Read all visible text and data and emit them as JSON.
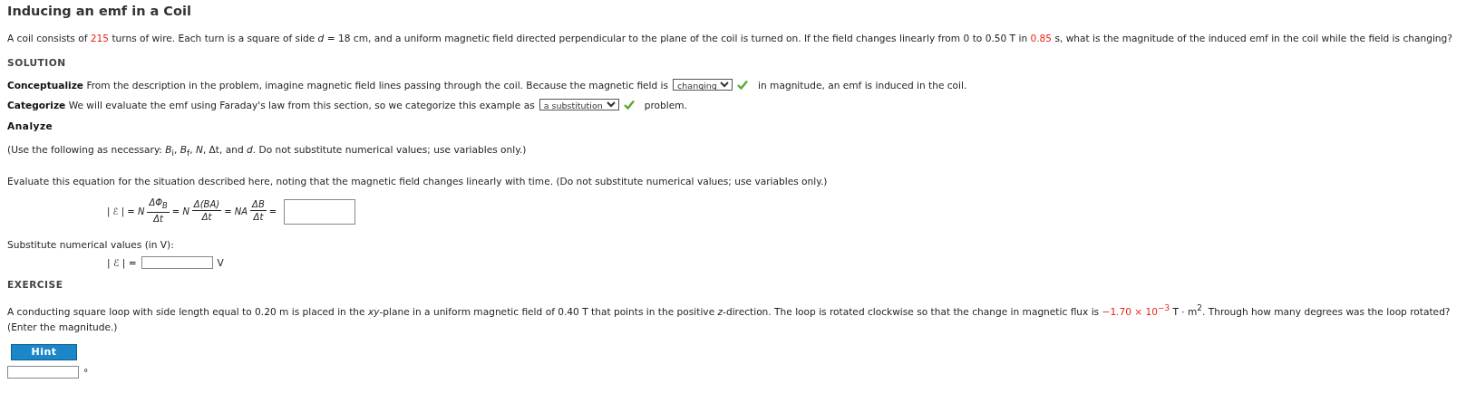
{
  "title": "Inducing an emf in a Coil",
  "problem": [
    {
      "kind": "plain",
      "text": "A coil consists of "
    },
    {
      "kind": "value",
      "text": "215"
    },
    {
      "kind": "plain",
      "text": " turns of wire. Each turn is a square of side *d* = 18 cm, and a uniform magnetic field directed perpendicular to the plane of the coil is turned on. If the field changes linearly from 0 to 0.50 T in "
    },
    {
      "kind": "value",
      "text": "0.85"
    },
    {
      "kind": "plain",
      "text": " s, what is the magnitude of the induced emf in the coil while the field is changing?"
    }
  ],
  "solution_heading": "SOLUTION",
  "steps": [
    {
      "label": "Conceptualize",
      "before": "From the description in the problem, imagine magnetic field lines passing through the coil. Because the magnetic field is",
      "choice": {
        "value": "changing",
        "correct": true
      },
      "after": "in magnitude, an emf is induced in the coil."
    },
    {
      "label": "Categorize",
      "before": "We will evaluate the emf using Faraday's law from this section, so we categorize this example as",
      "choice": {
        "value": "a substitution",
        "correct": true
      },
      "after": "problem."
    }
  ],
  "analyze": {
    "heading": "Analyze",
    "note": "(Use the following as necessary: *B*$_{i}$, *B*$_{f}$, *N*, Δt, and *d*. Do not substitute numerical values; use variables only.)",
    "instruction": "Evaluate this equation for the situation described here, noting that the magnetic field changes linearly with time. (Do not substitute numerical values; use variables only.)",
    "equation": [
      {
        "kind": "text",
        "text": "| ℰ | = *N*"
      },
      {
        "kind": "fraction",
        "top": "ΔΦ$_{B}$",
        "bottom": "Δt"
      },
      {
        "kind": "text",
        "text": "= *N*"
      },
      {
        "kind": "fraction",
        "top": "Δ(BA)",
        "bottom": "Δt"
      },
      {
        "kind": "text",
        "text": "= *NA*"
      },
      {
        "kind": "fraction",
        "top": "ΔB",
        "bottom": "Δt"
      },
      {
        "kind": "text",
        "text": "="
      }
    ],
    "substitute": "Substitute numerical values (in V):",
    "result_label": "| ℰ | =",
    "result_unit": "V"
  },
  "exercise": {
    "heading": "EXERCISE",
    "text": [
      {
        "kind": "plain",
        "text": "A conducting square loop with side length equal to 0.20 m is placed in the *xy*-plane in a uniform magnetic field of 0.40 T that points in the positive *z*-direction. The loop is rotated clockwise so that the change in magnetic flux is "
      },
      {
        "kind": "value",
        "text": "−1.70 × 10$^{−3}$"
      },
      {
        "kind": "plain",
        "text": " T · m$^{2}$. Through how many degrees was the loop rotated? (Enter the magnitude.)"
      }
    ],
    "hint": "Hint",
    "unit": "°"
  }
}
